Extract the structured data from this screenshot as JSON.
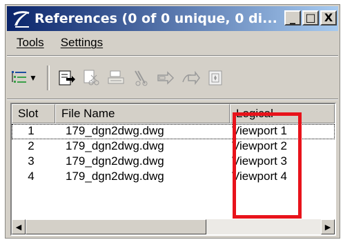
{
  "window": {
    "title": "References (0 of 0 unique, 0 di...",
    "icon": "microstation-logo-icon",
    "controls": [
      "minimize",
      "maximize",
      "close"
    ],
    "control_glyphs": {
      "minimize": "_",
      "maximize": "□",
      "close": "X"
    }
  },
  "menu": {
    "tools": "Tools",
    "settings": "Settings"
  },
  "toolbar": {
    "icons": [
      "list-view-icon",
      "attach-reference-icon",
      "detach-reference-icon",
      "reload-reference-icon",
      "exchange-reference-icon",
      "move-reference-icon",
      "copy-reference-icon",
      "settings-reference-icon"
    ]
  },
  "list": {
    "headers": {
      "slot": "Slot",
      "file_name": "File Name",
      "logical": "Logical"
    },
    "rows": [
      {
        "slot": "1",
        "file_name": "179_dgn2dwg.dwg",
        "logical": "Viewport 1"
      },
      {
        "slot": "2",
        "file_name": "179_dgn2dwg.dwg",
        "logical": "Viewport 2"
      },
      {
        "slot": "3",
        "file_name": "179_dgn2dwg.dwg",
        "logical": "Viewport 3"
      },
      {
        "slot": "4",
        "file_name": "179_dgn2dwg.dwg",
        "logical": "Viewport 4"
      }
    ]
  },
  "annotation": {
    "highlight_color": "#e8131b"
  },
  "colors": {
    "titlebar_start": "#0a246a",
    "titlebar_end": "#a6caf0",
    "face": "#d4d0c8"
  }
}
